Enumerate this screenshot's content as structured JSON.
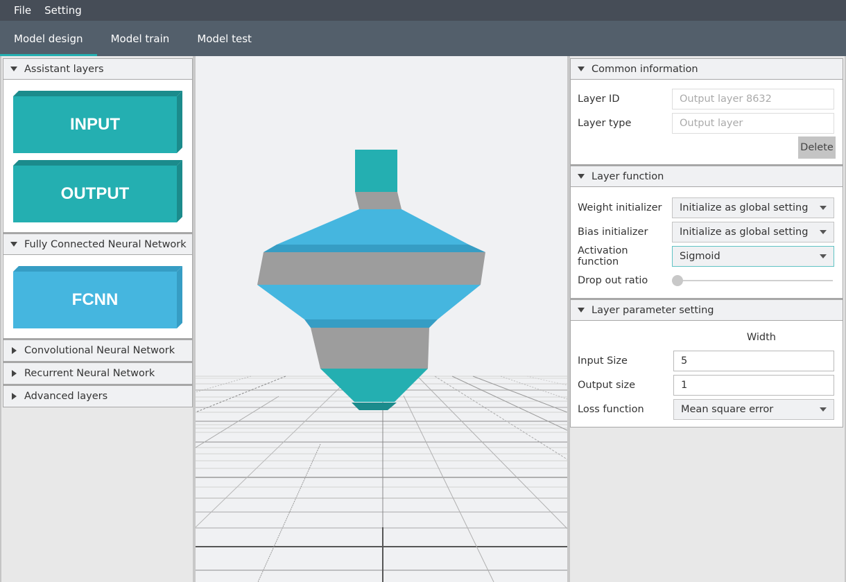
{
  "menu": {
    "items": [
      "File",
      "Setting"
    ]
  },
  "tabs": [
    {
      "label": "Model design",
      "active": true
    },
    {
      "label": "Model train",
      "active": false
    },
    {
      "label": "Model test",
      "active": false
    }
  ],
  "left_panel": {
    "sections": [
      {
        "title": "Assistant layers",
        "expanded": true,
        "blocks": [
          {
            "label": "INPUT",
            "color": "#24afb1"
          },
          {
            "label": "OUTPUT",
            "color": "#24afb1"
          }
        ]
      },
      {
        "title": "Fully Connected Neural Network",
        "expanded": true,
        "blocks": [
          {
            "label": "FCNN",
            "color": "#45b6df"
          }
        ]
      },
      {
        "title": "Convolutional Neural Network",
        "expanded": false
      },
      {
        "title": "Recurrent Neural Network",
        "expanded": false
      },
      {
        "title": "Advanced layers",
        "expanded": false
      }
    ]
  },
  "right_panel": {
    "common": {
      "title": "Common information",
      "layer_id_label": "Layer ID",
      "layer_id_placeholder": "Output layer 8632",
      "layer_type_label": "Layer type",
      "layer_type_placeholder": "Output layer",
      "delete_label": "Delete"
    },
    "function": {
      "title": "Layer function",
      "weight_label": "Weight initializer",
      "weight_value": "Initialize as global setting",
      "bias_label": "Bias initializer",
      "bias_value": "Initialize as global setting",
      "activation_label": "Activation function",
      "activation_value": "Sigmoid",
      "dropout_label": "Drop out ratio",
      "dropout_value": 0
    },
    "params": {
      "title": "Layer parameter setting",
      "column_header": "Width",
      "input_label": "Input Size",
      "input_value": "5",
      "output_label": "Output size",
      "output_value": "1",
      "loss_label": "Loss function",
      "loss_value": "Mean square error"
    }
  },
  "colors": {
    "teal": "#24afb1",
    "teal_dark": "#1b8b8c",
    "blue": "#45b6df",
    "blue_dark": "#369dc4",
    "gray": "#9d9d9d",
    "accent": "#25b0b1"
  },
  "model_stack": [
    "output-layer",
    "connector",
    "fcnn-layer",
    "connector",
    "input-layer"
  ]
}
